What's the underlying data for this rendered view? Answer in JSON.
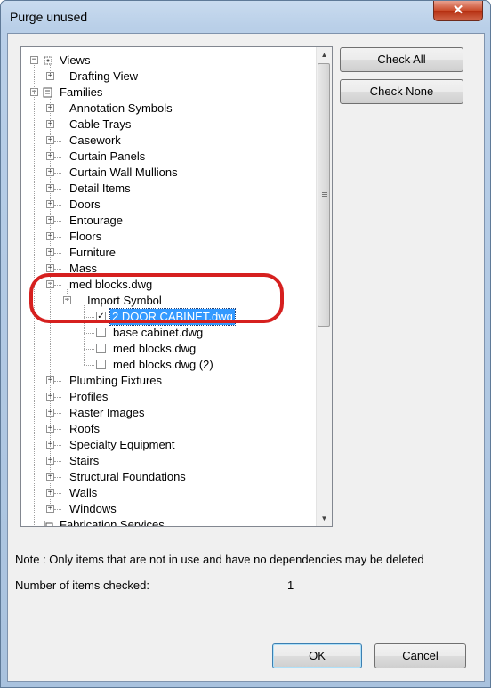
{
  "window": {
    "title": "Purge unused",
    "close_glyph": "✕"
  },
  "tree": {
    "rows": [
      {
        "label": "Views",
        "level": 0,
        "expander": "-",
        "icon": "views-icon"
      },
      {
        "label": "Drafting View",
        "level": 1,
        "expander": "+"
      },
      {
        "label": "Families",
        "level": 0,
        "expander": "-",
        "icon": "families-icon"
      },
      {
        "label": "Annotation Symbols",
        "level": 1,
        "expander": "+"
      },
      {
        "label": "Cable Trays",
        "level": 1,
        "expander": "+"
      },
      {
        "label": "Casework",
        "level": 1,
        "expander": "+"
      },
      {
        "label": "Curtain Panels",
        "level": 1,
        "expander": "+"
      },
      {
        "label": "Curtain Wall Mullions",
        "level": 1,
        "expander": "+"
      },
      {
        "label": "Detail Items",
        "level": 1,
        "expander": "+"
      },
      {
        "label": "Doors",
        "level": 1,
        "expander": "+"
      },
      {
        "label": "Entourage",
        "level": 1,
        "expander": "+"
      },
      {
        "label": "Floors",
        "level": 1,
        "expander": "+"
      },
      {
        "label": "Furniture",
        "level": 1,
        "expander": "+"
      },
      {
        "label": "Mass",
        "level": 1,
        "expander": "+"
      },
      {
        "label": "med blocks.dwg",
        "level": 1,
        "expander": "-"
      },
      {
        "label": "Import Symbol",
        "level": 2,
        "expander": "-"
      },
      {
        "label": "2 DOOR CABINET.dwg",
        "level": 3,
        "checked": true,
        "selected": true
      },
      {
        "label": "base cabinet.dwg",
        "level": 3,
        "checked": false
      },
      {
        "label": "med blocks.dwg",
        "level": 3,
        "checked": false
      },
      {
        "label": "med blocks.dwg (2)",
        "level": 3,
        "checked": false
      },
      {
        "label": "Plumbing Fixtures",
        "level": 1,
        "expander": "+"
      },
      {
        "label": "Profiles",
        "level": 1,
        "expander": "+"
      },
      {
        "label": "Raster Images",
        "level": 1,
        "expander": "+"
      },
      {
        "label": "Roofs",
        "level": 1,
        "expander": "+"
      },
      {
        "label": "Specialty Equipment",
        "level": 1,
        "expander": "+"
      },
      {
        "label": "Stairs",
        "level": 1,
        "expander": "+"
      },
      {
        "label": "Structural Foundations",
        "level": 1,
        "expander": "+"
      },
      {
        "label": "Walls",
        "level": 1,
        "expander": "+"
      },
      {
        "label": "Windows",
        "level": 1,
        "expander": "+"
      },
      {
        "label": "Fabrication Services",
        "level": 0,
        "expander": "",
        "icon": "fabrication-icon"
      }
    ],
    "check_glyph": "✓",
    "scroll_up_glyph": "▲",
    "scroll_down_glyph": "▼"
  },
  "buttons": {
    "check_all": "Check All",
    "check_none": "Check None",
    "ok": "OK",
    "cancel": "Cancel"
  },
  "footer": {
    "note": "Note : Only items that are not in use and have no dependencies may be deleted",
    "count_label": "Number of items checked:",
    "count_value": "1"
  },
  "colors": {
    "selection": "#3399ff",
    "annotation_ring": "#d6201f"
  }
}
